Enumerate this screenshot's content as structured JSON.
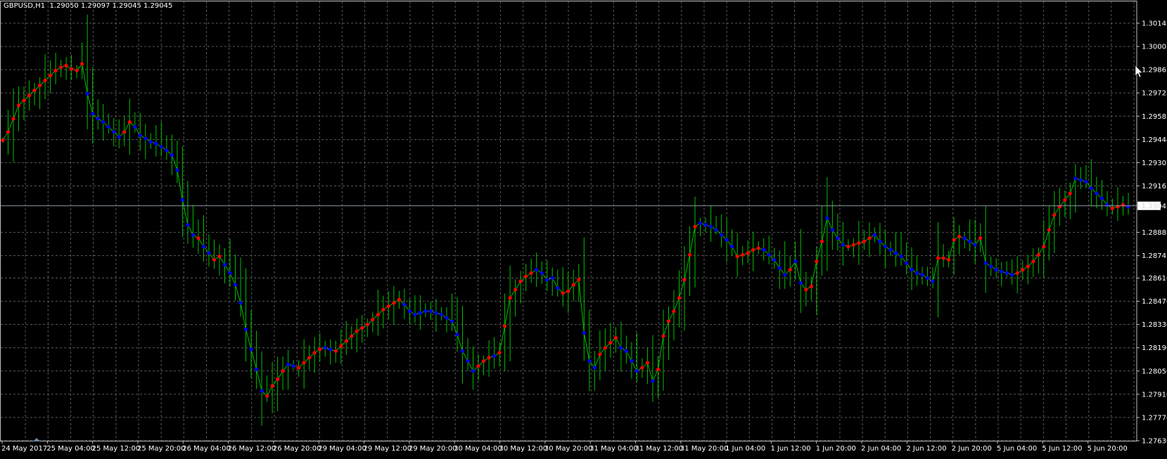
{
  "chart_header": {
    "symbol_tf": "GBPUSD,H1",
    "ohlc": "1.29050 1.29097 1.29045 1.29045"
  },
  "colors": {
    "background": "#000000",
    "grid": "#5a5a5a",
    "bar": "#00c000",
    "line": "#00c000",
    "marker_up": "#ff0000",
    "marker_down": "#0000ff",
    "axis": "#c0c0c0",
    "bid_line": "#8c9aa5",
    "text": "#ffffff"
  },
  "chart_data": {
    "type": "line",
    "title": "GBPUSD,H1",
    "price_labels": [
      "1.30145",
      "1.30005",
      "1.29865",
      "1.29725",
      "1.29585",
      "1.29444",
      "1.29305",
      "1.29165",
      "1.29045",
      "1.28885",
      "1.28745",
      "1.28610",
      "1.28470",
      "1.28330",
      "1.28190",
      "1.28050",
      "1.27910",
      "1.27770",
      "1.27630"
    ],
    "time_labels": [
      "24 May 2017",
      "25 May 04:00",
      "25 May 12:00",
      "25 May 20:00",
      "26 May 04:00",
      "26 May 12:00",
      "26 May 20:00",
      "29 May 04:00",
      "29 May 12:00",
      "29 May 20:00",
      "30 May 04:00",
      "30 May 12:00",
      "30 May 20:00",
      "31 May 04:00",
      "31 May 12:00",
      "31 May 20:00",
      "1 Jun 04:00",
      "1 Jun 12:00",
      "1 Jun 20:00",
      "2 Jun 04:00",
      "2 Jun 12:00",
      "2 Jun 20:00",
      "5 Jun 04:00",
      "5 Jun 12:00",
      "5 Jun 20:00"
    ],
    "ylim": [
      1.2763,
      1.30145
    ],
    "current_price": 1.29045,
    "grid": true,
    "series": [
      {
        "close": [
          1.2944,
          1.2949,
          1.2957,
          1.2965,
          1.2968,
          1.2971,
          1.2974,
          1.2977,
          1.298,
          1.2983,
          1.2986,
          1.2988,
          1.2989,
          1.2987,
          1.2986,
          1.299,
          1.2972,
          1.296,
          1.2957,
          1.2955,
          1.2952,
          1.2949,
          1.2946,
          1.2949,
          1.2955,
          1.2952,
          1.2947,
          1.2945,
          1.2943,
          1.2942,
          1.294,
          1.2938,
          1.2935,
          1.2926,
          1.2908,
          1.2893,
          1.2887,
          1.2885,
          1.288,
          1.2876,
          1.2872,
          1.2874,
          1.2869,
          1.2864,
          1.2857,
          1.2846,
          1.283,
          1.2818,
          1.2806,
          1.2793,
          1.279,
          1.2796,
          1.28,
          1.2805,
          1.2809,
          1.2808,
          1.2807,
          1.281,
          1.2813,
          1.2816,
          1.2818,
          1.2819,
          1.2818,
          1.2817,
          1.282,
          1.2823,
          1.2826,
          1.2829,
          1.2831,
          1.2833,
          1.2836,
          1.2839,
          1.2842,
          1.2844,
          1.2846,
          1.2848,
          1.2845,
          1.2841,
          1.2839,
          1.284,
          1.2841,
          1.2841,
          1.284,
          1.2839,
          1.2837,
          1.2835,
          1.2827,
          1.2817,
          1.2811,
          1.2805,
          1.2808,
          1.2811,
          1.2813,
          1.2814,
          1.2816,
          1.2832,
          1.2849,
          1.2854,
          1.2859,
          1.2862,
          1.2864,
          1.2866,
          1.2864,
          1.286,
          1.2861,
          1.2855,
          1.2852,
          1.2853,
          1.2857,
          1.286,
          1.2828,
          1.2811,
          1.2807,
          1.2815,
          1.2819,
          1.2822,
          1.2825,
          1.2819,
          1.2817,
          1.2811,
          1.2805,
          1.2807,
          1.281,
          1.2799,
          1.2806,
          1.2826,
          1.2835,
          1.2841,
          1.2849,
          1.286,
          1.2875,
          1.2892,
          1.2894,
          1.2893,
          1.2892,
          1.289,
          1.2887,
          1.2884,
          1.288,
          1.2874,
          1.2875,
          1.2876,
          1.2878,
          1.2879,
          1.2878,
          1.2875,
          1.2872,
          1.2867,
          1.2863,
          1.2866,
          1.2871,
          1.2858,
          1.2854,
          1.2856,
          1.2871,
          1.2883,
          1.2897,
          1.289,
          1.2885,
          1.2881,
          1.288,
          1.2881,
          1.2882,
          1.2883,
          1.2885,
          1.2887,
          1.2883,
          1.288,
          1.2878,
          1.2876,
          1.2874,
          1.287,
          1.2866,
          1.2864,
          1.2863,
          1.2861,
          1.2859,
          1.2873,
          1.2873,
          1.2872,
          1.2884,
          1.2886,
          1.2885,
          1.2883,
          1.2881,
          1.2885,
          1.287,
          1.2868,
          1.2866,
          1.2865,
          1.2864,
          1.2863,
          1.2864,
          1.2866,
          1.2868,
          1.2871,
          1.2875,
          1.288,
          1.289,
          1.2899,
          1.2904,
          1.2908,
          1.2912,
          1.2921,
          1.292,
          1.2919,
          1.2915,
          1.2912,
          1.2909,
          1.2905,
          1.2903,
          1.2904,
          1.2905,
          1.2904
        ],
        "signal": [
          1,
          1,
          1,
          1,
          1,
          1,
          1,
          1,
          1,
          1,
          1,
          1,
          1,
          1,
          1,
          1,
          0,
          0,
          0,
          0,
          0,
          0,
          0,
          1,
          1,
          0,
          0,
          0,
          0,
          0,
          0,
          0,
          0,
          0,
          0,
          0,
          0,
          1,
          0,
          0,
          1,
          1,
          0,
          0,
          0,
          0,
          0,
          0,
          0,
          0,
          1,
          1,
          1,
          1,
          0,
          0,
          1,
          1,
          1,
          1,
          1,
          0,
          0,
          1,
          1,
          1,
          1,
          1,
          1,
          1,
          1,
          1,
          1,
          1,
          1,
          1,
          0,
          0,
          0,
          0,
          0,
          0,
          0,
          0,
          0,
          0,
          0,
          0,
          0,
          0,
          1,
          1,
          1,
          0,
          1,
          1,
          1,
          1,
          1,
          1,
          1,
          0,
          0,
          0,
          0,
          0,
          1,
          1,
          1,
          1,
          0,
          0,
          0,
          1,
          1,
          1,
          1,
          0,
          0,
          0,
          0,
          1,
          1,
          0,
          1,
          1,
          1,
          1,
          1,
          1,
          1,
          1,
          0,
          0,
          0,
          0,
          0,
          0,
          0,
          1,
          1,
          1,
          1,
          1,
          0,
          0,
          0,
          0,
          0,
          1,
          0,
          0,
          1,
          1,
          1,
          1,
          0,
          0,
          0,
          0,
          1,
          1,
          1,
          1,
          1,
          0,
          0,
          0,
          0,
          0,
          0,
          0,
          0,
          0,
          0,
          0,
          0,
          1,
          1,
          1,
          1,
          1,
          0,
          0,
          0,
          1,
          0,
          0,
          0,
          0,
          0,
          0,
          1,
          1,
          1,
          1,
          1,
          1,
          1,
          1,
          1,
          1,
          1,
          0,
          0,
          0,
          0,
          0,
          0,
          0,
          1,
          1,
          1
        ]
      }
    ]
  }
}
